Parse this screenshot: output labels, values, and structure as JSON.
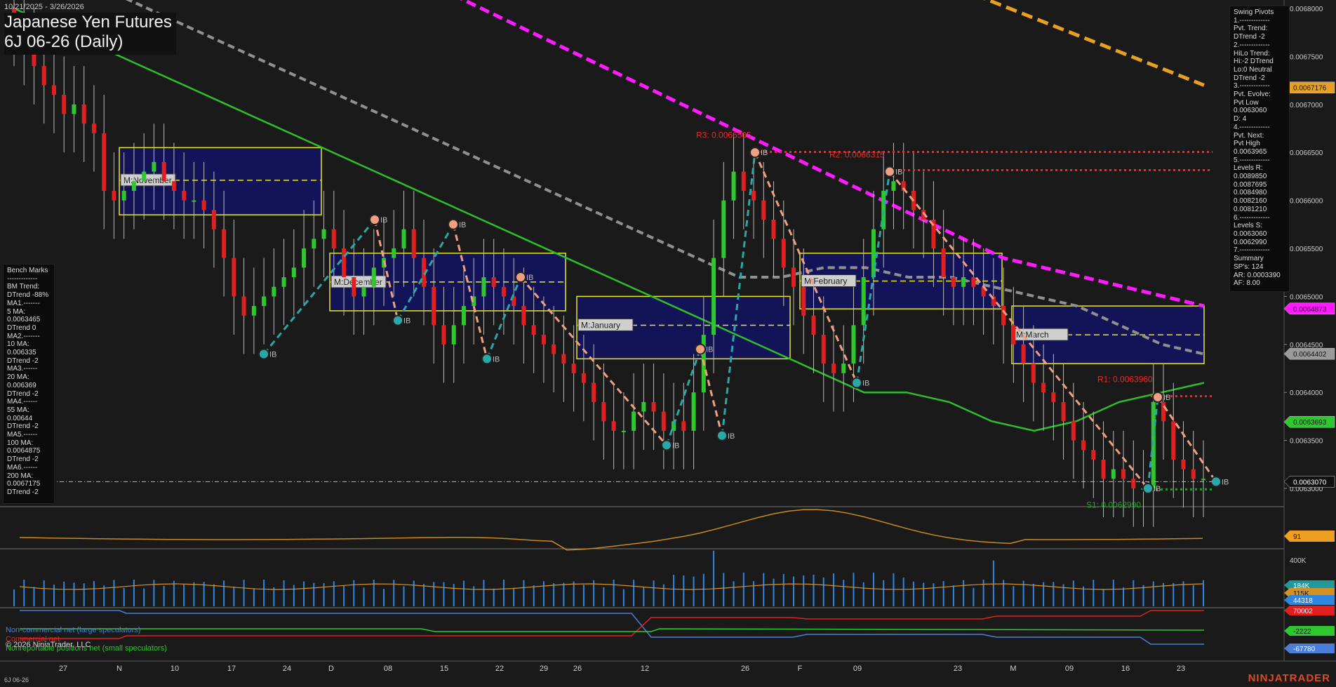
{
  "header": {
    "date_range": "10/21/2025 - 3/26/2026",
    "title": "Japanese Yen Futures",
    "subtitle": "6J 06-26 (Daily)"
  },
  "bench_marks": {
    "lines": [
      "Bench Marks",
      "-------------",
      "BM Trend:",
      "DTrend -88%",
      "MA1.-------",
      "5 MA:",
      "0.0063465",
      "DTrend 0",
      "MA2.-------",
      "10 MA:",
      "0.006335",
      "DTrend -2",
      "MA3.------",
      "20 MA:",
      "0.006369",
      "DTrend -2",
      "MA4.------",
      "55 MA:",
      "0.00644",
      "DTrend -2",
      "MA5.------",
      "100 MA:",
      "0.0064875",
      "DTrend -2",
      "MA6.------",
      "200 MA:",
      "0.0067175",
      "DTrend -2"
    ]
  },
  "swing_pivots": {
    "lines": [
      "Swing Pivots",
      "1.-------------",
      "Pvt. Trend:",
      "DTrend -2",
      "2.-------------",
      "HiLo Trend:",
      "Hi:-2 DTrend",
      "Lo:0 Neutral",
      "DTrend -2",
      "3.-------------",
      "Pvt. Evolve:",
      "Pvt Low",
      "0.0063060",
      "D: 4",
      "4.-------------",
      "Pvt. Next:",
      "Pvt High",
      "0.0063965",
      "5.-------------",
      "Levels R:",
      "0.0089850",
      "0.0087695",
      "0.0084980",
      "0.0082160",
      "0.0081210",
      "6.-------------",
      "Levels S:",
      "0.0063060",
      "0.0062990",
      "7.-------------",
      "Summary",
      "SP's: 124",
      "AR: 0.0003390",
      "AF: 8.00"
    ]
  },
  "legend": {
    "noncommercial": "Non-commercial net (large speculators)",
    "commercial": "Commercial net",
    "copyright": "© 2026 NinjaTrader, LLC",
    "nonreportable": "Nonreportable positions net (small speculators)"
  },
  "footer": {
    "symbol": "6J 06-26",
    "brand": "NINJATRADER"
  },
  "colors": {
    "background": "#1a1a1a",
    "up_candle": "#2ec82e",
    "down_candle": "#e02020",
    "ma20": "#2bc02b",
    "ma55": "#909090",
    "ma100": "#ff1aff",
    "ma200": "#e8a020",
    "swing_up": "#2aa8a8",
    "swing_down": "#f0a080",
    "month_box": "#12126e",
    "month_border": "#e8e820",
    "resistance": "#ff2020",
    "support": "#20a020",
    "volume": "#2f86e0",
    "noncommercial": "#4a7ed8",
    "commercial": "#e02020",
    "nonreportable": "#2ec82e"
  },
  "chart_data": {
    "type": "candlestick",
    "title": "Japanese Yen Futures 6J 06-26 (Daily)",
    "ylim": [
      0.0063,
      0.0068
    ],
    "y_ticks": [
      "0.0068000",
      "0.0067500",
      "0.0067000",
      "0.0066500",
      "0.0066000",
      "0.0065500",
      "0.0065000",
      "0.0064500",
      "0.0064000",
      "0.0063500",
      "0.0063000"
    ],
    "x_ticks": [
      "27",
      "N",
      "10",
      "17",
      "24",
      "D",
      "08",
      "15",
      "22",
      "29",
      "26",
      "12",
      "26",
      "F",
      "09",
      "23",
      "M",
      "09",
      "16",
      "23"
    ],
    "price_labels": [
      {
        "text": "0.0067176",
        "value": 0.0067176,
        "color": "#e8a020",
        "tc": "#111"
      },
      {
        "text": "0.0064873",
        "value": 0.0064873,
        "color": "#ff1aff",
        "tc": "#111"
      },
      {
        "text": "0.0064402",
        "value": 0.0064402,
        "color": "#9a9a9a",
        "tc": "#111"
      },
      {
        "text": "0.0063693",
        "value": 0.0063693,
        "color": "#2ec82e",
        "tc": "#111"
      },
      {
        "text": "0.0063070",
        "value": 0.006307,
        "color": "#111111",
        "tc": "#fff"
      }
    ],
    "closes": [
      0.00678,
      0.00676,
      0.00674,
      0.00672,
      0.00671,
      0.00669,
      0.0067,
      0.00668,
      0.00667,
      0.00661,
      0.0066,
      0.00661,
      0.00662,
      0.00663,
      0.00664,
      0.00662,
      0.00661,
      0.0066,
      0.0066,
      0.00659,
      0.00657,
      0.00654,
      0.0065,
      0.00648,
      0.00649,
      0.0065,
      0.00651,
      0.00652,
      0.00653,
      0.00655,
      0.00656,
      0.00657,
      0.00655,
      0.00652,
      0.0065,
      0.00651,
      0.00653,
      0.00654,
      0.00655,
      0.00657,
      0.00654,
      0.00651,
      0.00647,
      0.00645,
      0.00647,
      0.00649,
      0.0065,
      0.00652,
      0.00651,
      0.0065,
      0.00649,
      0.00647,
      0.00646,
      0.00645,
      0.00644,
      0.00643,
      0.00642,
      0.00641,
      0.00639,
      0.00637,
      0.00636,
      0.00636,
      0.00638,
      0.00639,
      0.00638,
      0.00636,
      0.00637,
      0.00636,
      0.0064,
      0.00646,
      0.00654,
      0.0066,
      0.00663,
      0.00661,
      0.0066,
      0.00658,
      0.00656,
      0.00653,
      0.00651,
      0.00648,
      0.00646,
      0.00643,
      0.00642,
      0.00643,
      0.00647,
      0.00652,
      0.00657,
      0.00661,
      0.00662,
      0.00661,
      0.00659,
      0.00658,
      0.00655,
      0.00652,
      0.00651,
      0.00652,
      0.00651,
      0.0065,
      0.00649,
      0.00647,
      0.00645,
      0.00643,
      0.00641,
      0.0064,
      0.00639,
      0.00637,
      0.00635,
      0.00634,
      0.00633,
      0.00631,
      0.00632,
      0.00631,
      0.0063,
      0.0063,
      0.00639,
      0.00637,
      0.00633,
      0.00632,
      0.00631,
      0.00631
    ],
    "ma20": [
      0.0068,
      0.00678,
      0.00676,
      0.00674,
      0.00672,
      0.0067,
      0.00668,
      0.00666,
      0.00664,
      0.00662,
      0.0066,
      0.00658,
      0.00656,
      0.00654,
      0.00652,
      0.0065,
      0.00648,
      0.00646,
      0.00644,
      0.00642,
      0.0064,
      0.0064,
      0.00639,
      0.00637,
      0.00636,
      0.00637,
      0.00639,
      0.0064,
      0.00641
    ],
    "ma55": [
      0.00682,
      0.0068,
      0.00678,
      0.00676,
      0.00674,
      0.00672,
      0.0067,
      0.00668,
      0.00666,
      0.00664,
      0.00662,
      0.0066,
      0.00658,
      0.00656,
      0.00654,
      0.00652,
      0.00652,
      0.00653,
      0.00653,
      0.00652,
      0.00652,
      0.00651,
      0.0065,
      0.00649,
      0.00647,
      0.00645,
      0.00644
    ],
    "ma100": [
      0.0069,
      0.00688,
      0.00686,
      0.00684,
      0.00682,
      0.0068,
      0.00678,
      0.00676,
      0.00674,
      0.00672,
      0.0067,
      0.00668,
      0.00666,
      0.00664,
      0.00662,
      0.0066,
      0.00658,
      0.00656,
      0.00654,
      0.00653,
      0.00652,
      0.00651,
      0.0065,
      0.00649
    ],
    "ma200": [
      0.00684,
      0.0068,
      0.00676,
      0.00672
    ],
    "swing_points": [
      {
        "label": "IB",
        "value": 0.00644,
        "kind": "low"
      },
      {
        "label": "IB",
        "value": 0.00658,
        "kind": "high"
      },
      {
        "label": "IB",
        "value": 0.006475,
        "kind": "low"
      },
      {
        "label": "IB",
        "value": 0.006575,
        "kind": "high"
      },
      {
        "label": "IB",
        "value": 0.006435,
        "kind": "low"
      },
      {
        "label": "IB",
        "value": 0.00652,
        "kind": "high"
      },
      {
        "label": "IB",
        "value": 0.006345,
        "kind": "low"
      },
      {
        "label": "IB",
        "value": 0.006445,
        "kind": "high"
      },
      {
        "label": "IB",
        "value": 0.006355,
        "kind": "low"
      },
      {
        "label": "IB",
        "value": 0.00665,
        "kind": "high"
      },
      {
        "label": "IB",
        "value": 0.00641,
        "kind": "low"
      },
      {
        "label": "IB",
        "value": 0.00663,
        "kind": "high"
      },
      {
        "label": "IB",
        "value": 0.0063,
        "kind": "low"
      },
      {
        "label": "IB",
        "value": 0.006395,
        "kind": "high"
      },
      {
        "label": "IB",
        "value": 0.006307,
        "kind": "low"
      }
    ],
    "pivot_levels": [
      {
        "label": "R3: 0.0066505",
        "value": 0.0066505,
        "color": "#ff2020"
      },
      {
        "label": "R2: 0.0066315",
        "value": 0.0066315,
        "color": "#ff2020"
      },
      {
        "label": "R1: 0.0063960",
        "value": 0.006396,
        "color": "#ff2020"
      },
      {
        "label": "S1: 0.0062990",
        "value": 0.006299,
        "color": "#20a020"
      }
    ],
    "month_boxes": [
      {
        "label": "M:November",
        "high": 0.006655,
        "low": 0.006585,
        "mid": 0.006621
      },
      {
        "label": "M:December",
        "high": 0.006545,
        "low": 0.006485,
        "mid": 0.006515
      },
      {
        "label": "M:January",
        "high": 0.0065,
        "low": 0.006435,
        "mid": 0.00647
      },
      {
        "label": "M:February",
        "high": 0.006545,
        "low": 0.006487,
        "mid": 0.006516
      },
      {
        "label": "M:March",
        "high": 0.00649,
        "low": 0.00643,
        "mid": 0.00646
      }
    ],
    "osc_panel": {
      "label": "91",
      "value": 91
    },
    "volume_panel": {
      "labels": [
        "400K",
        "184K",
        "115K",
        "44318"
      ]
    },
    "cot_panel": {
      "series": [
        {
          "name": "Non-commercial net (large speculators)",
          "last": -67780
        },
        {
          "name": "Commercial net",
          "last": 70002
        },
        {
          "name": "Nonreportable positions net (small speculators)",
          "last": -2222
        }
      ],
      "labels": [
        "70002",
        "-2222",
        "-67780"
      ]
    }
  }
}
